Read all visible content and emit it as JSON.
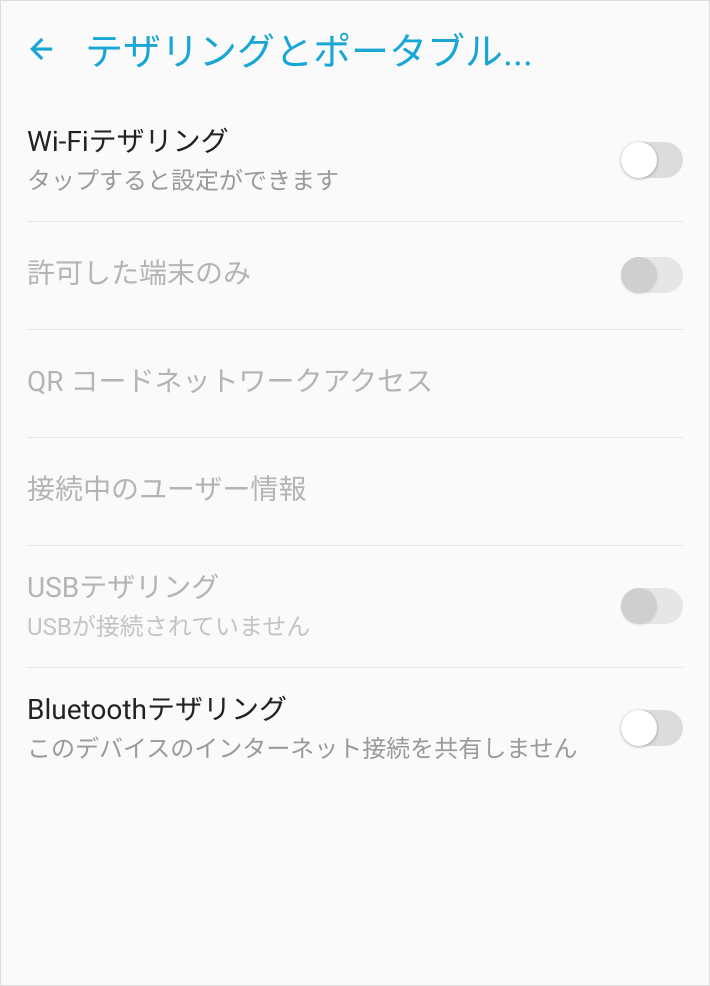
{
  "header": {
    "title": "テザリングとポータブル..."
  },
  "rows": [
    {
      "title": "Wi-Fiテザリング",
      "subtitle": "タップすると設定ができます",
      "hasToggle": true,
      "disabled": false,
      "toggleDisabled": false
    },
    {
      "title": "許可した端末のみ",
      "subtitle": "",
      "hasToggle": true,
      "disabled": true,
      "toggleDisabled": true
    },
    {
      "title": "QR コードネットワークアクセス",
      "subtitle": "",
      "hasToggle": false,
      "disabled": true,
      "toggleDisabled": false
    },
    {
      "title": "接続中のユーザー情報",
      "subtitle": "",
      "hasToggle": false,
      "disabled": true,
      "toggleDisabled": false
    },
    {
      "title": "USBテザリング",
      "subtitle": "USBが接続されていません",
      "hasToggle": true,
      "disabled": true,
      "toggleDisabled": true
    },
    {
      "title": "Bluetoothテザリング",
      "subtitle": "このデバイスのインターネット接続を共有しません",
      "hasToggle": true,
      "disabled": false,
      "toggleDisabled": false
    }
  ]
}
